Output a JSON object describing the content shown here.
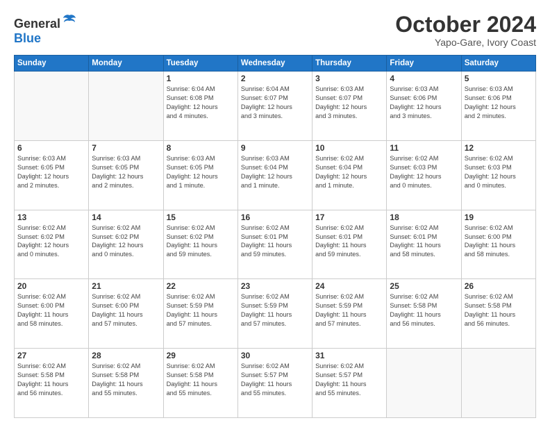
{
  "header": {
    "logo_line1": "General",
    "logo_line2": "Blue",
    "month": "October 2024",
    "location": "Yapo-Gare, Ivory Coast"
  },
  "weekdays": [
    "Sunday",
    "Monday",
    "Tuesday",
    "Wednesday",
    "Thursday",
    "Friday",
    "Saturday"
  ],
  "weeks": [
    [
      {
        "day": "",
        "info": ""
      },
      {
        "day": "",
        "info": ""
      },
      {
        "day": "1",
        "info": "Sunrise: 6:04 AM\nSunset: 6:08 PM\nDaylight: 12 hours\nand 4 minutes."
      },
      {
        "day": "2",
        "info": "Sunrise: 6:04 AM\nSunset: 6:07 PM\nDaylight: 12 hours\nand 3 minutes."
      },
      {
        "day": "3",
        "info": "Sunrise: 6:03 AM\nSunset: 6:07 PM\nDaylight: 12 hours\nand 3 minutes."
      },
      {
        "day": "4",
        "info": "Sunrise: 6:03 AM\nSunset: 6:06 PM\nDaylight: 12 hours\nand 3 minutes."
      },
      {
        "day": "5",
        "info": "Sunrise: 6:03 AM\nSunset: 6:06 PM\nDaylight: 12 hours\nand 2 minutes."
      }
    ],
    [
      {
        "day": "6",
        "info": "Sunrise: 6:03 AM\nSunset: 6:05 PM\nDaylight: 12 hours\nand 2 minutes."
      },
      {
        "day": "7",
        "info": "Sunrise: 6:03 AM\nSunset: 6:05 PM\nDaylight: 12 hours\nand 2 minutes."
      },
      {
        "day": "8",
        "info": "Sunrise: 6:03 AM\nSunset: 6:05 PM\nDaylight: 12 hours\nand 1 minute."
      },
      {
        "day": "9",
        "info": "Sunrise: 6:03 AM\nSunset: 6:04 PM\nDaylight: 12 hours\nand 1 minute."
      },
      {
        "day": "10",
        "info": "Sunrise: 6:02 AM\nSunset: 6:04 PM\nDaylight: 12 hours\nand 1 minute."
      },
      {
        "day": "11",
        "info": "Sunrise: 6:02 AM\nSunset: 6:03 PM\nDaylight: 12 hours\nand 0 minutes."
      },
      {
        "day": "12",
        "info": "Sunrise: 6:02 AM\nSunset: 6:03 PM\nDaylight: 12 hours\nand 0 minutes."
      }
    ],
    [
      {
        "day": "13",
        "info": "Sunrise: 6:02 AM\nSunset: 6:02 PM\nDaylight: 12 hours\nand 0 minutes."
      },
      {
        "day": "14",
        "info": "Sunrise: 6:02 AM\nSunset: 6:02 PM\nDaylight: 12 hours\nand 0 minutes."
      },
      {
        "day": "15",
        "info": "Sunrise: 6:02 AM\nSunset: 6:02 PM\nDaylight: 11 hours\nand 59 minutes."
      },
      {
        "day": "16",
        "info": "Sunrise: 6:02 AM\nSunset: 6:01 PM\nDaylight: 11 hours\nand 59 minutes."
      },
      {
        "day": "17",
        "info": "Sunrise: 6:02 AM\nSunset: 6:01 PM\nDaylight: 11 hours\nand 59 minutes."
      },
      {
        "day": "18",
        "info": "Sunrise: 6:02 AM\nSunset: 6:01 PM\nDaylight: 11 hours\nand 58 minutes."
      },
      {
        "day": "19",
        "info": "Sunrise: 6:02 AM\nSunset: 6:00 PM\nDaylight: 11 hours\nand 58 minutes."
      }
    ],
    [
      {
        "day": "20",
        "info": "Sunrise: 6:02 AM\nSunset: 6:00 PM\nDaylight: 11 hours\nand 58 minutes."
      },
      {
        "day": "21",
        "info": "Sunrise: 6:02 AM\nSunset: 6:00 PM\nDaylight: 11 hours\nand 57 minutes."
      },
      {
        "day": "22",
        "info": "Sunrise: 6:02 AM\nSunset: 5:59 PM\nDaylight: 11 hours\nand 57 minutes."
      },
      {
        "day": "23",
        "info": "Sunrise: 6:02 AM\nSunset: 5:59 PM\nDaylight: 11 hours\nand 57 minutes."
      },
      {
        "day": "24",
        "info": "Sunrise: 6:02 AM\nSunset: 5:59 PM\nDaylight: 11 hours\nand 57 minutes."
      },
      {
        "day": "25",
        "info": "Sunrise: 6:02 AM\nSunset: 5:58 PM\nDaylight: 11 hours\nand 56 minutes."
      },
      {
        "day": "26",
        "info": "Sunrise: 6:02 AM\nSunset: 5:58 PM\nDaylight: 11 hours\nand 56 minutes."
      }
    ],
    [
      {
        "day": "27",
        "info": "Sunrise: 6:02 AM\nSunset: 5:58 PM\nDaylight: 11 hours\nand 56 minutes."
      },
      {
        "day": "28",
        "info": "Sunrise: 6:02 AM\nSunset: 5:58 PM\nDaylight: 11 hours\nand 55 minutes."
      },
      {
        "day": "29",
        "info": "Sunrise: 6:02 AM\nSunset: 5:58 PM\nDaylight: 11 hours\nand 55 minutes."
      },
      {
        "day": "30",
        "info": "Sunrise: 6:02 AM\nSunset: 5:57 PM\nDaylight: 11 hours\nand 55 minutes."
      },
      {
        "day": "31",
        "info": "Sunrise: 6:02 AM\nSunset: 5:57 PM\nDaylight: 11 hours\nand 55 minutes."
      },
      {
        "day": "",
        "info": ""
      },
      {
        "day": "",
        "info": ""
      }
    ]
  ]
}
